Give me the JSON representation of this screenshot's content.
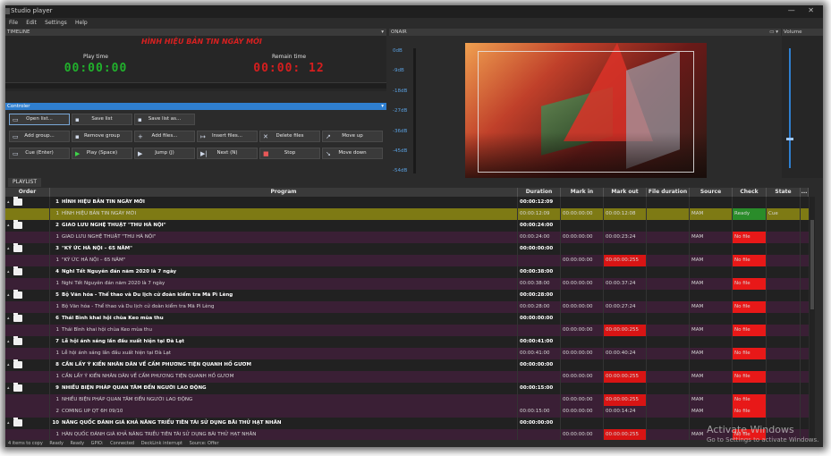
{
  "window": {
    "title": "Studio player",
    "controls": "—  ✕"
  },
  "menu": [
    "File",
    "Edit",
    "Settings",
    "Help"
  ],
  "timeline": {
    "header": "TIMELINE",
    "now_title": "HÌNH HIỆU BẢN TIN NGÀY MỚI",
    "play_label": "Play time",
    "play_value": "00:00:00",
    "remain_label": "Remain time",
    "remain_value": "00:00: 12"
  },
  "controller": {
    "header": "Controler",
    "buttons": {
      "open": "Open list...",
      "save": "Save list",
      "save_as": "Save list as...",
      "add_group": "Add group...",
      "remove_group": "Remove group",
      "add_files": "Add files...",
      "insert_files": "Insert files...",
      "delete_files": "Delete files",
      "move_up": "Move up",
      "cue": "Cue (Enter)",
      "play": "Play (Space)",
      "jump": "Jump (J)",
      "next": "Next (N)",
      "stop": "Stop",
      "move_down": "Move down"
    }
  },
  "onair": {
    "header": "ONAIR",
    "levels": [
      "0dB",
      "-9dB",
      "-18dB",
      "-27dB",
      "-36dB",
      "-45dB",
      "-54dB"
    ]
  },
  "volume": {
    "header": "Volume",
    "level_percent": 15
  },
  "playlist": {
    "tab": "PLAYLIST",
    "columns": {
      "order": "Order",
      "program": "Program",
      "duration": "Duration",
      "mark_in": "Mark in",
      "mark_out": "Mark out",
      "file_duration": "File duration",
      "source": "Source",
      "check": "Check",
      "state": "State",
      "more": "..."
    },
    "rows": [
      {
        "type": "group",
        "num": "1",
        "program": "HÌNH HIỆU BẢN TIN NGÀY MỚI",
        "duration": "00:00:12:09"
      },
      {
        "type": "item",
        "cur": true,
        "num": "1",
        "program": "HÌNH HIỆU BẢN TIN NGÀY MỚI",
        "duration": "00:00:12:09",
        "mark_in": "00:00:00:00",
        "mark_out": "00:00:12:08",
        "source": "MAM",
        "check": "Ready",
        "check_status": "ok",
        "state": "Cue"
      },
      {
        "type": "group",
        "num": "2",
        "program": "GIAO LƯU NGHỆ THUẬT \"THU HÀ NỘI\"",
        "duration": "00:00:24:00"
      },
      {
        "type": "item",
        "num": "1",
        "program": "GIAO LƯU NGHỆ THUẬT \"THU HÀ NỘI\"",
        "duration": "00:00:24:00",
        "mark_in": "00:00:00:00",
        "mark_out": "00:00:23:24",
        "source": "MAM",
        "check": "No file",
        "check_status": "err"
      },
      {
        "type": "group",
        "num": "3",
        "program": "\"KÝ ỨC HÀ NỘI – 65 NĂM\"",
        "duration": "00:00:00:00"
      },
      {
        "type": "item",
        "num": "1",
        "program": "\"KÝ ỨC HÀ NỘI – 65 NĂM\"",
        "duration": "",
        "mark_in": "00:00:00:00",
        "mark_out": "00:00:00:255",
        "mark_out_status": "err",
        "source": "MAM",
        "check": "No file",
        "check_status": "err"
      },
      {
        "type": "group",
        "num": "4",
        "program": "Nghi Tết Nguyên đán năm 2020 là 7 ngày",
        "duration": "00:00:38:00"
      },
      {
        "type": "item",
        "num": "1",
        "program": "Nghi Tết Nguyên đán năm 2020 là 7 ngày",
        "duration": "00:00:38:00",
        "mark_in": "00:00:00:00",
        "mark_out": "00:00:37:24",
        "source": "MAM",
        "check": "No file",
        "check_status": "err"
      },
      {
        "type": "group",
        "num": "5",
        "program": "Bộ Văn hóa - Thể thao và Du lịch cử đoàn kiểm tra Mã Pì Lèng",
        "duration": "00:00:28:00"
      },
      {
        "type": "item",
        "num": "1",
        "program": "Bộ Văn hóa - Thể thao và Du lịch cử đoàn kiểm tra Mã Pì Lèng",
        "duration": "00:00:28:00",
        "mark_in": "00:00:00:00",
        "mark_out": "00:00:27:24",
        "source": "MAM",
        "check": "No file",
        "check_status": "err"
      },
      {
        "type": "group",
        "num": "6",
        "program": "Thái Bình khai hội chùa Keo mùa thu",
        "duration": "00:00:00:00"
      },
      {
        "type": "item",
        "num": "1",
        "program": "Thái Bình khai hội chùa Keo mùa thu",
        "duration": "",
        "mark_in": "00:00:00:00",
        "mark_out": "00:00:00:255",
        "mark_out_status": "err",
        "source": "MAM",
        "check": "No file",
        "check_status": "err"
      },
      {
        "type": "group",
        "num": "7",
        "program": "Lễ hội ánh sáng lần đầu xuất hiện tại Đà Lạt",
        "duration": "00:00:41:00"
      },
      {
        "type": "item",
        "num": "1",
        "program": "Lễ hội ánh sáng lần đầu xuất hiện tại Đà Lạt",
        "duration": "00:00:41:00",
        "mark_in": "00:00:00:00",
        "mark_out": "00:00:40:24",
        "source": "MAM",
        "check": "No file",
        "check_status": "err"
      },
      {
        "type": "group",
        "num": "8",
        "program": "CẦN LẤY Ý KIẾN NHÂN DÂN VỀ CẤM PHƯƠNG TIỆN QUANH HỒ GƯƠM",
        "duration": "00:00:00:00"
      },
      {
        "type": "item",
        "num": "1",
        "program": "CẦN LẤY Ý KIẾN NHÂN DÂN VỀ CẤM PHƯƠNG TIỆN QUANH HỒ GƯƠM",
        "duration": "",
        "mark_in": "00:00:00:00",
        "mark_out": "00:00:00:255",
        "mark_out_status": "err",
        "source": "MAM",
        "check": "No file",
        "check_status": "err"
      },
      {
        "type": "group",
        "num": "9",
        "program": "NHIỀU BIỆN PHÁP QUAN TÂM ĐẾN NGƯỜI LAO ĐỘNG",
        "duration": "00:00:15:00"
      },
      {
        "type": "item",
        "num": "1",
        "program": "NHIỀU BIỆN PHÁP QUAN TÂM ĐẾN NGƯỜI LAO ĐỘNG",
        "duration": "",
        "mark_in": "00:00:00:00",
        "mark_out": "00:00:00:255",
        "mark_out_status": "err",
        "source": "MAM",
        "check": "No file",
        "check_status": "err"
      },
      {
        "type": "item",
        "num": "2",
        "program": "COMING UP QT 6H 09/10",
        "duration": "00:00:15:00",
        "mark_in": "00:00:00:00",
        "mark_out": "00:00:14:24",
        "source": "MAM",
        "check": "No file",
        "check_status": "err"
      },
      {
        "type": "group",
        "num": "10",
        "program": "NÂNG QUỐC ĐÁNH GIÁ KHẢ NĂNG TRIỂU TIÊN TÁI SỬ DỤNG BÃI THỬ HẠT NHÂN",
        "duration": "00:00:00:00"
      },
      {
        "type": "item",
        "num": "1",
        "program": "HÀN QUỐC ĐÁNH GIÁ KHẢ NĂNG TRIỀU TIÊN TÁI SỬ DỤNG BÃI THỬ HẠT NHÂN",
        "duration": "",
        "mark_in": "00:00:00:00",
        "mark_out": "00:00:00:255",
        "mark_out_status": "err",
        "source": "MAM",
        "check": "No file",
        "check_status": "err"
      }
    ]
  },
  "status": [
    "4 items to copy",
    "Ready",
    "Ready",
    "GPIO:",
    "Connected",
    "DeckLink interrupt",
    "Source: Offer"
  ],
  "watermark": {
    "line1": "Activate Windows",
    "line2": "Go to Settings to activate Windows."
  },
  "colors": {
    "accent": "#2f7fd0",
    "play_clock": "#21b12c",
    "remain_clock": "#d61e1e",
    "error": "#e81818",
    "ok": "#2a8c2a",
    "current_row": "#7e7a14"
  }
}
